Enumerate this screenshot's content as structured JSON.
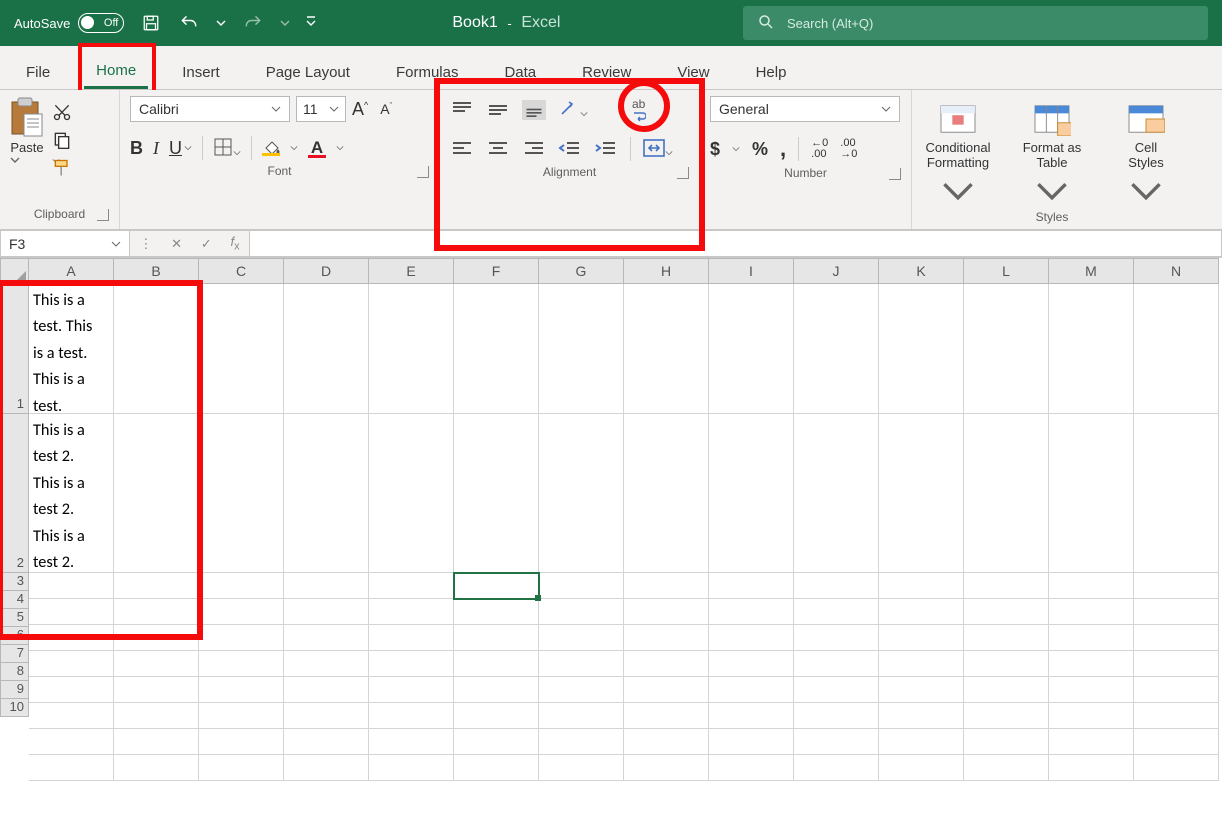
{
  "titlebar": {
    "autosave_label": "AutoSave",
    "autosave_state": "Off",
    "doc_name": "Book1",
    "app_name": "Excel",
    "search_placeholder": "Search (Alt+Q)"
  },
  "tabs": [
    "File",
    "Home",
    "Insert",
    "Page Layout",
    "Formulas",
    "Data",
    "Review",
    "View",
    "Help"
  ],
  "active_tab": "Home",
  "ribbon": {
    "clipboard": {
      "paste_label": "Paste",
      "group_label": "Clipboard"
    },
    "font": {
      "name": "Calibri",
      "size": "11",
      "group_label": "Font",
      "bold": "B",
      "italic": "I",
      "underline": "U",
      "grow": "A",
      "shrink": "A",
      "color": "A",
      "fill": "A"
    },
    "alignment": {
      "wrap_text": "ab",
      "group_label": "Alignment"
    },
    "number": {
      "format": "General",
      "group_label": "Number",
      "currency": "$",
      "percent": "%",
      "comma": ",",
      "inc": ".00",
      "dec": ".00"
    },
    "styles": {
      "cond_fmt": "Conditional\nFormatting",
      "fmt_table": "Format as\nTable",
      "cell_styles": "Cell\nStyles",
      "group_label": "Styles"
    }
  },
  "namebox": "F3",
  "formula": "",
  "columns": [
    "A",
    "B",
    "C",
    "D",
    "E",
    "F",
    "G",
    "H",
    "I",
    "J",
    "K",
    "L",
    "M",
    "N"
  ],
  "rows": [
    "1",
    "2",
    "3",
    "4",
    "5",
    "6",
    "7",
    "8",
    "9",
    "10"
  ],
  "cells": {
    "A1": "This is a\ntest. This\nis a test.\nThis is a\ntest.",
    "A2": "This is a\ntest 2.\nThis is a\ntest 2.\nThis is a\ntest 2."
  },
  "selected_cell": "F3"
}
